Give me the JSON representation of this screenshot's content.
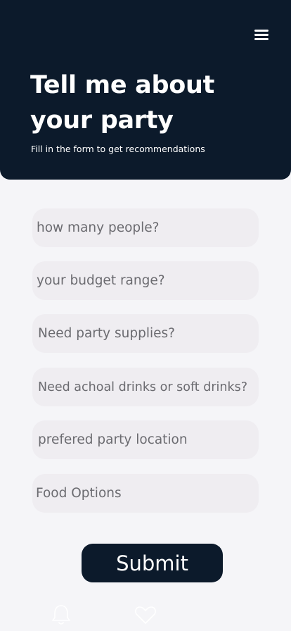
{
  "header": {
    "title": "Tell me about your party",
    "subtitle": "Fill in the form to get recommendations"
  },
  "form": {
    "fields": [
      {
        "placeholder": "how many people?"
      },
      {
        "placeholder": "your budget range?"
      },
      {
        "placeholder": "Need party supplies?"
      },
      {
        "placeholder": "Need achoal drinks or soft drinks?"
      },
      {
        "placeholder": "prefered party location"
      },
      {
        "placeholder": "Food Options"
      }
    ],
    "submit_label": "Submit"
  },
  "tabbar": {
    "icons": [
      "bell-icon",
      "heart-icon"
    ]
  },
  "colors": {
    "header_bg": "#0c1a2b",
    "page_bg": "#f5f5f8",
    "field_bg": "#efedf1",
    "placeholder_text": "#6b6b70",
    "submit_bg": "#0c1a2b"
  }
}
